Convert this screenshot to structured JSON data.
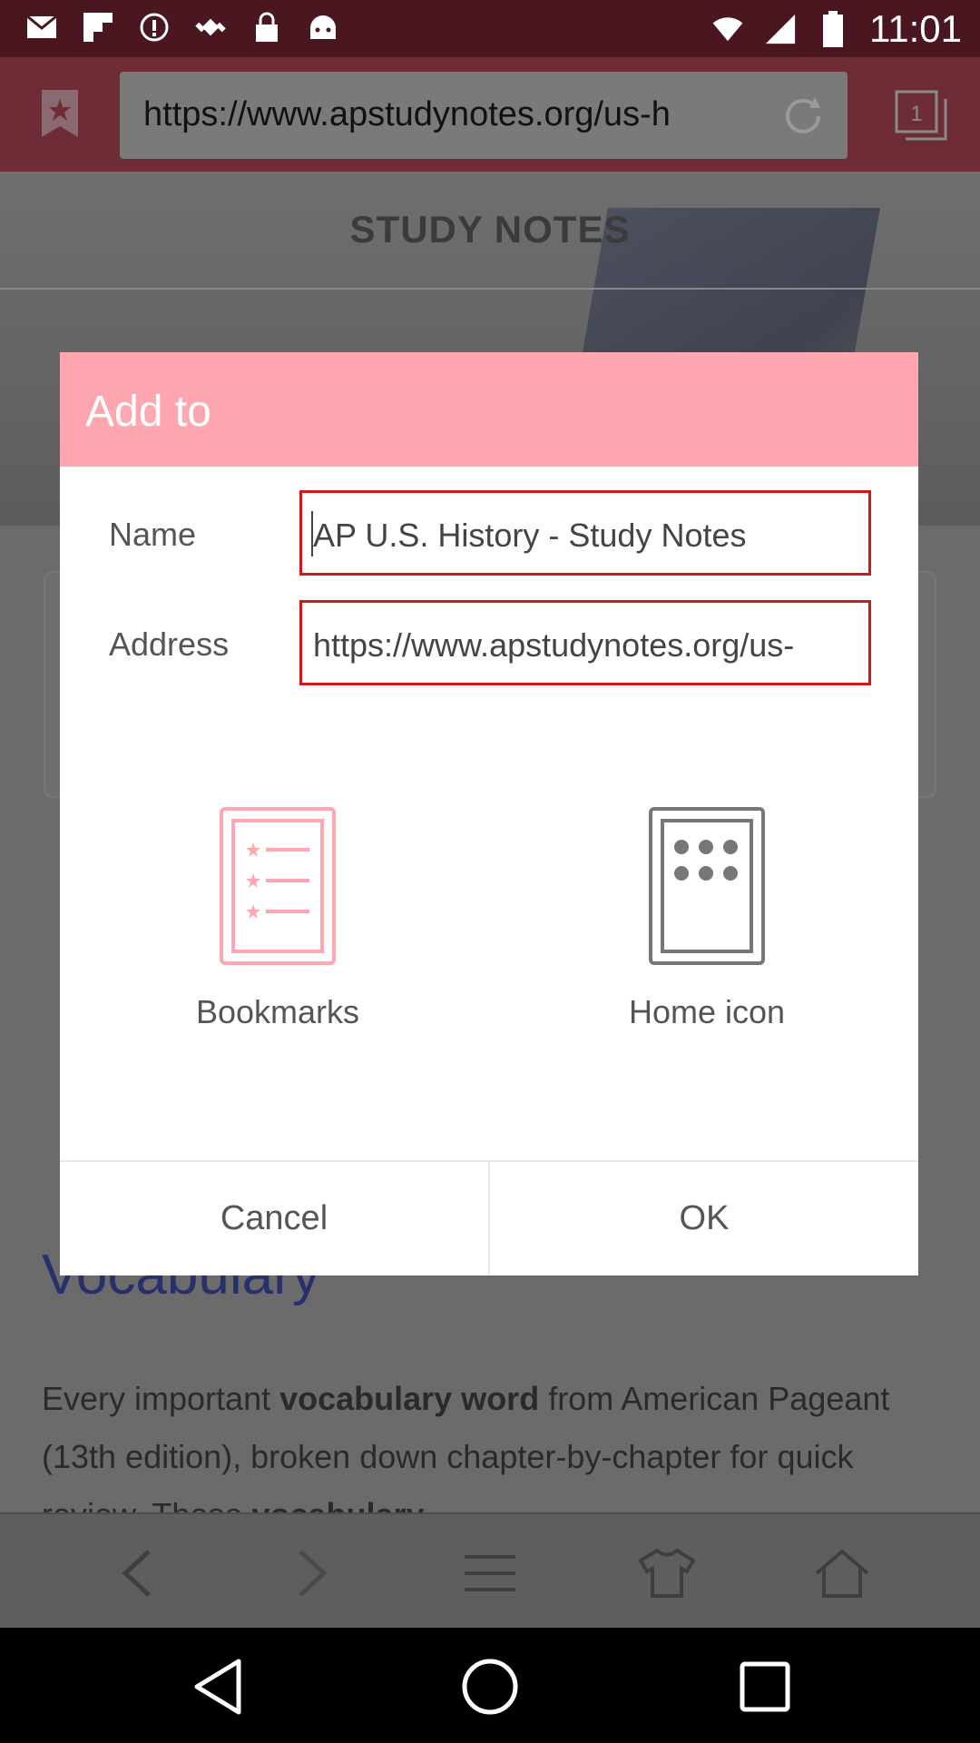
{
  "status_bar": {
    "time": "11:01",
    "icons": [
      "mail-icon",
      "flipboard-icon",
      "alert-icon",
      "fake-gps-icon",
      "lock-icon",
      "android-icon",
      "wifi-icon",
      "signal-icon",
      "battery-icon"
    ]
  },
  "browser": {
    "url": "https://www.apstudynotes.org/us-h",
    "tab_count": "1"
  },
  "page": {
    "hero_title": "STUDY NOTES",
    "section_title": "Vocabulary",
    "paragraph_parts": [
      "Every important ",
      "vocabulary word",
      " from American Pageant (13th edition), broken down chapter-by-chapter for quick review. These ",
      "vocabulary"
    ]
  },
  "dialog": {
    "title": "Add to",
    "name_label": "Name",
    "name_value": "AP U.S. History - Study Notes",
    "address_label": "Address",
    "address_value": "https://www.apstudynotes.org/us-",
    "options": [
      {
        "label": "Bookmarks",
        "icon": "bookmarks-list-icon"
      },
      {
        "label": "Home icon",
        "icon": "home-grid-icon"
      }
    ],
    "cancel_label": "Cancel",
    "ok_label": "OK"
  },
  "colors": {
    "header_pink": "#ffa7b0",
    "field_border": "#d01818"
  }
}
